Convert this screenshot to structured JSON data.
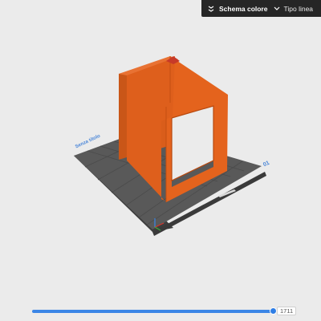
{
  "toolbar": {
    "toggle_icon": "chevrons-icon",
    "color_scheme_label": "Schema colore",
    "line_type_value": "Tipo linea"
  },
  "plate": {
    "name_label": "Senza titolo",
    "number_label": "01"
  },
  "layer_slider": {
    "value": "1711"
  },
  "colors": {
    "model": "#e4631d",
    "bed": "#595959",
    "background": "#ebebeb",
    "accent": "#3b86e6"
  }
}
